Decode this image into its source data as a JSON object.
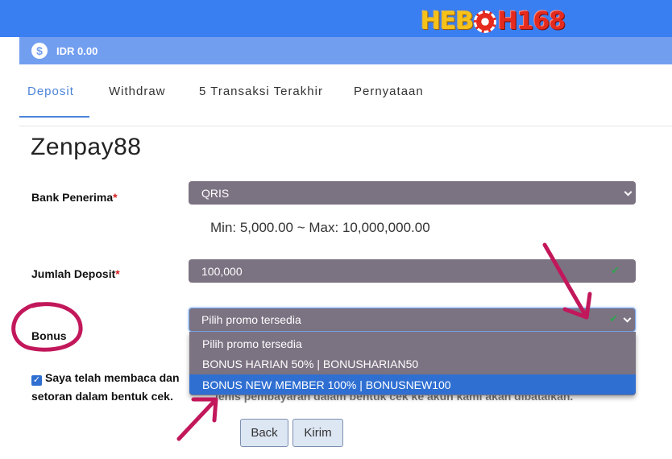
{
  "header": {
    "logo_part1": "HEB",
    "logo_part2": "H168",
    "logo_alt": "HEBOH168",
    "balance": "IDR 0.00",
    "balance_icon": "dollar-coin-icon"
  },
  "tabs": [
    {
      "label": "Deposit",
      "active": true
    },
    {
      "label": "Withdraw",
      "active": false
    },
    {
      "label": "5 Transaksi Terakhir",
      "active": false
    },
    {
      "label": "Pernyataan",
      "active": false
    }
  ],
  "form": {
    "title": "Zenpay88",
    "bank_label": "Bank Penerima",
    "bank_value": "QRIS",
    "limits": "Min: 5,000.00 ~ Max: 10,000,000.00",
    "amount_label": "Jumlah Deposit",
    "amount_value": "100,000",
    "required_mark": "*",
    "bonus_label": "Bonus",
    "bonus_value": "Pilih promo tersedia",
    "bonus_options": [
      "Pilih promo tersedia",
      "BONUS HARIAN 50% | BONUSHARIAN50",
      "BONUS NEW MEMBER 100% | BONUSNEW100"
    ],
    "terms_line1": "Saya telah membaca dan",
    "terms_line2": "setoran dalam bentuk cek.",
    "terms_line2_right": "jenis pembayaran dalam bentuk cek ke akun kami akan dibatalkan.",
    "terms_checked": true,
    "back_label": "Back",
    "submit_label": "Kirim"
  },
  "colors": {
    "topbar": "#3a7ff2",
    "balance_bar": "#729ef0",
    "field_bg": "#7b7282",
    "active_tab": "#4c84d8",
    "selected_option": "#2f6fd2",
    "annotation": "#c2185b"
  }
}
